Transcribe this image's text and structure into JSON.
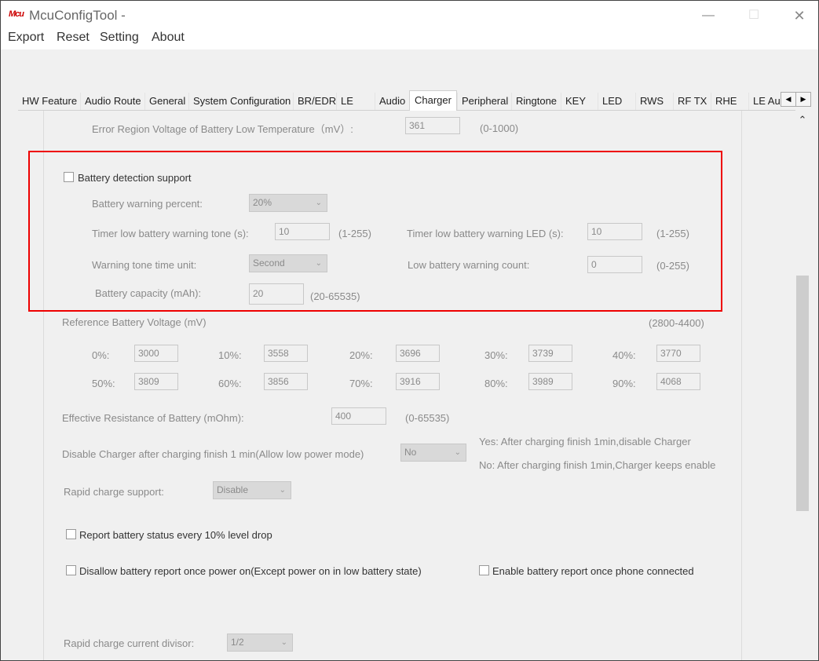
{
  "window": {
    "logo_text": "Mcu",
    "title": "McuConfigTool -",
    "minimize_glyph": "—",
    "maximize_glyph": "☐",
    "close_glyph": "✕"
  },
  "menu": {
    "export": "Export",
    "reset": "Reset",
    "setting": "Setting",
    "about": "About"
  },
  "tabs": [
    "HW Feature",
    "Audio Route",
    "General",
    "System Configuration",
    "BR/EDR",
    "LE",
    "Audio",
    "Charger",
    "Peripheral",
    "Ringtone",
    "KEY",
    "LED",
    "RWS",
    "RF TX",
    "RHE",
    "LE Au("
  ],
  "active_tab": "Charger",
  "tab_scroll": {
    "left": "◀",
    "right": "▶"
  },
  "vscroll_up": "⌃",
  "charger": {
    "error_region": {
      "label": "Error Region Voltage of Battery Low Temperature（mV）:",
      "value": "361",
      "range": "(0-1000)"
    },
    "battery_detection": {
      "checkbox_label": "Battery detection support",
      "checked": false,
      "warning_percent": {
        "label": "Battery warning percent:",
        "value": "20%"
      },
      "timer_tone": {
        "label": "Timer low battery warning tone (s):",
        "value": "10",
        "range": "(1-255)"
      },
      "timer_led": {
        "label": "Timer low battery warning LED (s):",
        "value": "10",
        "range": "(1-255)"
      },
      "tone_unit": {
        "label": "Warning tone time unit:",
        "value": "Second"
      },
      "warning_count": {
        "label": "Low battery warning count:",
        "value": "0",
        "range": "(0-255)"
      },
      "capacity": {
        "label": "Battery capacity (mAh):",
        "value": "20",
        "range": "(20-65535)"
      }
    },
    "reference_voltage": {
      "label": "Reference Battery Voltage  (mV)",
      "range": "(2800-4400)",
      "rows": [
        [
          {
            "label": "0%:",
            "value": "3000"
          },
          {
            "label": "10%:",
            "value": "3558"
          },
          {
            "label": "20%:",
            "value": "3696"
          },
          {
            "label": "30%:",
            "value": "3739"
          },
          {
            "label": "40%:",
            "value": "3770"
          }
        ],
        [
          {
            "label": "50%:",
            "value": "3809"
          },
          {
            "label": "60%:",
            "value": "3856"
          },
          {
            "label": "70%:",
            "value": "3916"
          },
          {
            "label": "80%:",
            "value": "3989"
          },
          {
            "label": "90%:",
            "value": "4068"
          }
        ]
      ]
    },
    "effective_resistance": {
      "label": "Effective Resistance of Battery (mOhm):",
      "value": "400",
      "range": "(0-65535)"
    },
    "disable_charger": {
      "label": "Disable Charger after charging finish 1 min(Allow low power mode)",
      "value": "No",
      "note_yes": "Yes: After charging finish 1min,disable Charger",
      "note_no": "No: After charging finish 1min,Charger keeps enable"
    },
    "rapid_charge": {
      "label": "Rapid charge support:",
      "value": "Disable"
    },
    "report_drop": {
      "label": "Report battery status every 10% level drop",
      "checked": false
    },
    "disallow_report": {
      "label": "Disallow battery report once power on(Except power on in low battery state)",
      "checked": false
    },
    "enable_report": {
      "label": "Enable battery report once phone connected",
      "checked": false
    },
    "rapid_divisor": {
      "label": "Rapid charge current divisor:",
      "value": "1/2"
    }
  }
}
